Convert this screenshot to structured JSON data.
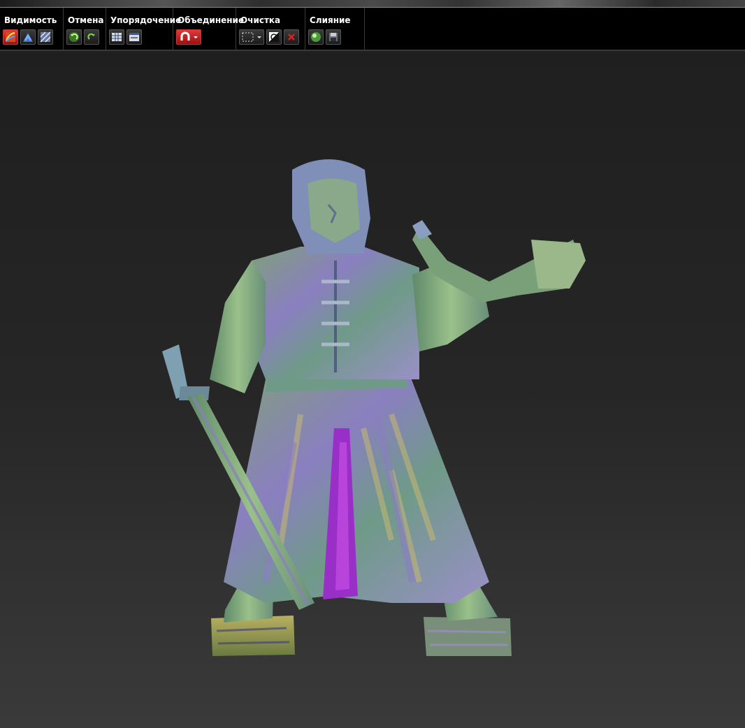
{
  "toolbar": {
    "groups": [
      {
        "label": "Видимость"
      },
      {
        "label": "Отмена"
      },
      {
        "label": "Упорядочение"
      },
      {
        "label": "Объединение"
      },
      {
        "label": "Очистка"
      },
      {
        "label": "Слияние"
      }
    ]
  },
  "icons": {
    "visibility": [
      "visibility-color-icon",
      "visibility-scan-icon",
      "visibility-mesh-icon"
    ],
    "undo": [
      "undo-icon",
      "redo-icon"
    ],
    "arrange": [
      "grid-view-icon",
      "list-view-icon"
    ],
    "combine": [
      "magnet-icon"
    ],
    "cleanup": [
      "selection-rect-icon",
      "invert-selection-icon",
      "delete-icon"
    ],
    "merge": [
      "merge-sphere-icon",
      "save-icon"
    ]
  },
  "colors": {
    "toolbar_bg": "#000000",
    "viewport_bg": "#262626",
    "accent_red": "#c41e1e"
  }
}
